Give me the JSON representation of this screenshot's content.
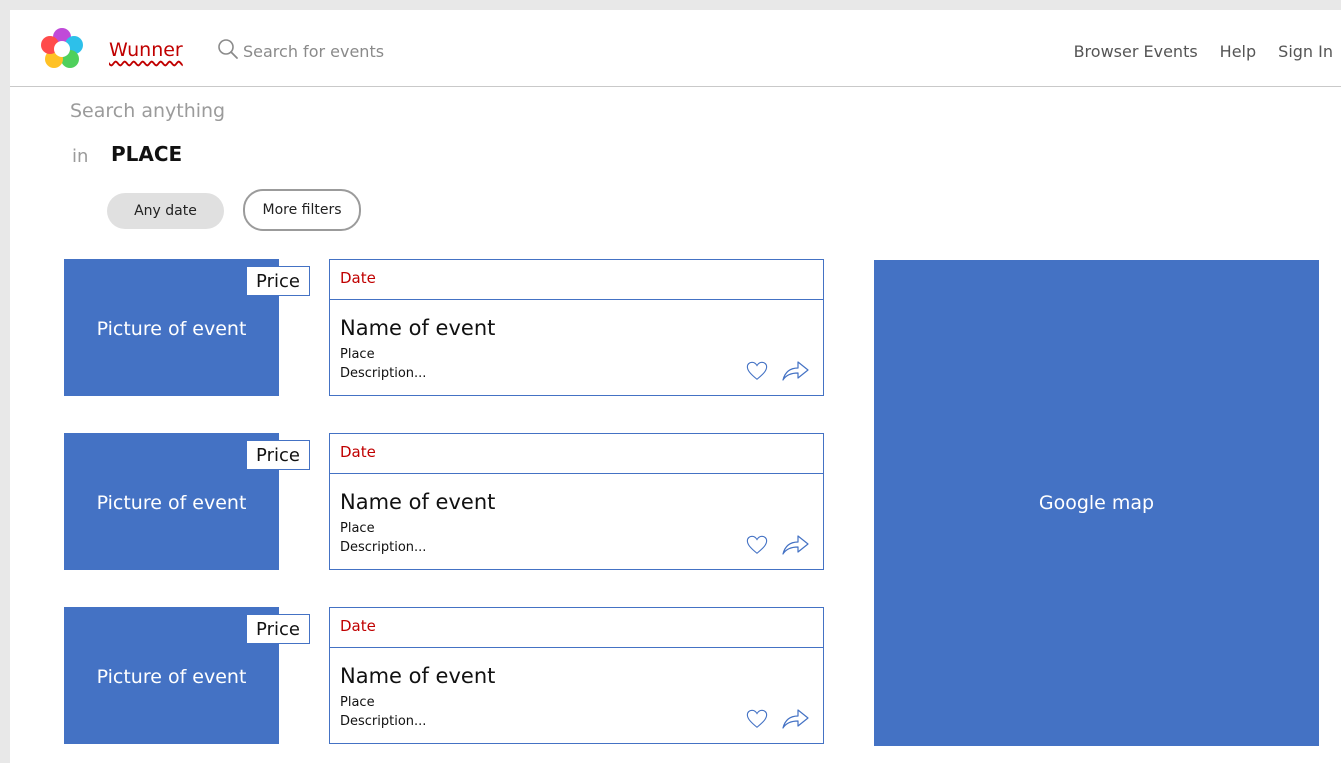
{
  "header": {
    "brand": "Wunner",
    "search_placeholder": "Search for events",
    "nav": {
      "browse": "Browser Events",
      "help": "Help",
      "sign_in": "Sign In"
    }
  },
  "search": {
    "heading": "Search anything",
    "in_label": "in",
    "place": "PLACE"
  },
  "filters": {
    "any_date": "Any date",
    "more_filters": "More filters"
  },
  "events": [
    {
      "picture": "Picture of event",
      "price": "Price",
      "date": "Date",
      "name": "Name of event",
      "place": "Place",
      "description": "Description..."
    },
    {
      "picture": "Picture of event",
      "price": "Price",
      "date": "Date",
      "name": "Name of event",
      "place": "Place",
      "description": "Description..."
    },
    {
      "picture": "Picture of event",
      "price": "Price",
      "date": "Date",
      "name": "Name of event",
      "place": "Place",
      "description": "Description..."
    }
  ],
  "map": {
    "label": "Google map"
  },
  "icons": {
    "logo": "flower-logo-icon",
    "search": "search-icon",
    "favorite": "heart-icon",
    "share": "share-arrow-icon"
  },
  "colors": {
    "accent_blue": "#4472c4",
    "brand_red": "#c00000",
    "muted_text": "#9b9b9b"
  }
}
